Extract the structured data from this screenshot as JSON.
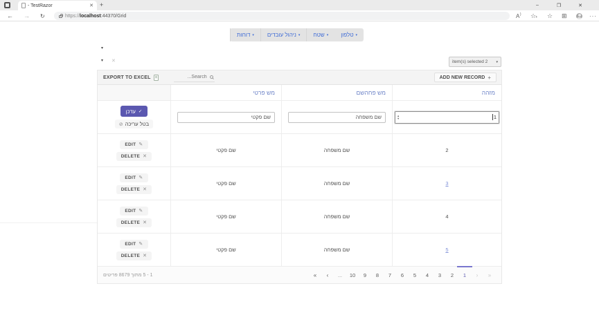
{
  "browser": {
    "tab_title": "- TestRazor",
    "tab_close_icon": "✕",
    "new_tab_label": "+",
    "window_controls": {
      "minimize": "–",
      "restore": "❐",
      "close": "✕"
    },
    "nav_icons": {
      "back": "←",
      "forward": "→",
      "refresh": "↻",
      "more": "···",
      "read_aloud": "A",
      "read_aloud_sup": ")",
      "favorite_star": "☆",
      "favorite_plus": "+",
      "favorites_bar_star": "☆",
      "collections": "⊞"
    },
    "url": {
      "protocol": "https://",
      "host": "localhost",
      "path": ":44370/Grid"
    }
  },
  "menu": {
    "caret": "▾",
    "items": [
      {
        "label": "טלפון"
      },
      {
        "label": "שטח"
      },
      {
        "label": "ניהול עובדים"
      },
      {
        "label": "דוחות"
      }
    ]
  },
  "filters": {
    "caret_top": "▾",
    "caret_row": "▾",
    "clear": "✕"
  },
  "selection_dropdown": {
    "label": "item(s) selected 2",
    "caret": "▾"
  },
  "grid": {
    "toolbar": {
      "export_label": "EXPORT TO EXCEL",
      "search_placeholder": "Search...",
      "add_label": "ADD NEW RECORD",
      "add_icon": "+"
    },
    "headers": {
      "id": "מזהה",
      "family": "מש פחהשם",
      "first": "מש פרטי"
    },
    "edit_row": {
      "id_value": "1",
      "family_value": "שם משפחה",
      "first_value": "שם פקטי",
      "update_label": "עדכן",
      "update_icon": "✓",
      "cancel_label": "בטל עריכה",
      "cancel_icon": "⊘",
      "spinner_up": "▴",
      "spinner_down": "▾"
    },
    "row_buttons": {
      "edit_label": "EDIT",
      "edit_icon": "✎",
      "delete_label": "DELETE",
      "delete_icon": "✕"
    },
    "rows": [
      {
        "id": "2",
        "family": "שם משפחה",
        "first": "שם פקטי",
        "id_is_link": false
      },
      {
        "id": "3",
        "family": "שם משפחה",
        "first": "שם פקטי",
        "id_is_link": true
      },
      {
        "id": "4",
        "family": "שם משפחה",
        "first": "שם פקטי",
        "id_is_link": false
      },
      {
        "id": "5",
        "family": "שם משפחה",
        "first": "שם פקטי",
        "id_is_link": true
      }
    ]
  },
  "pager": {
    "info": "1 - 5 מתוך 8679 פריטים",
    "first": "«",
    "prev": "‹",
    "ellipsis": "...",
    "numbers": [
      "10",
      "9",
      "8",
      "7",
      "6",
      "5",
      "4",
      "3",
      "2",
      "1"
    ],
    "current_page": "1",
    "next": "›",
    "last": "»"
  },
  "colors": {
    "accent": "#5b58b0",
    "header_text": "#6e84c8",
    "menu_link": "#3e6bd6",
    "id_link": "#8191d8"
  }
}
